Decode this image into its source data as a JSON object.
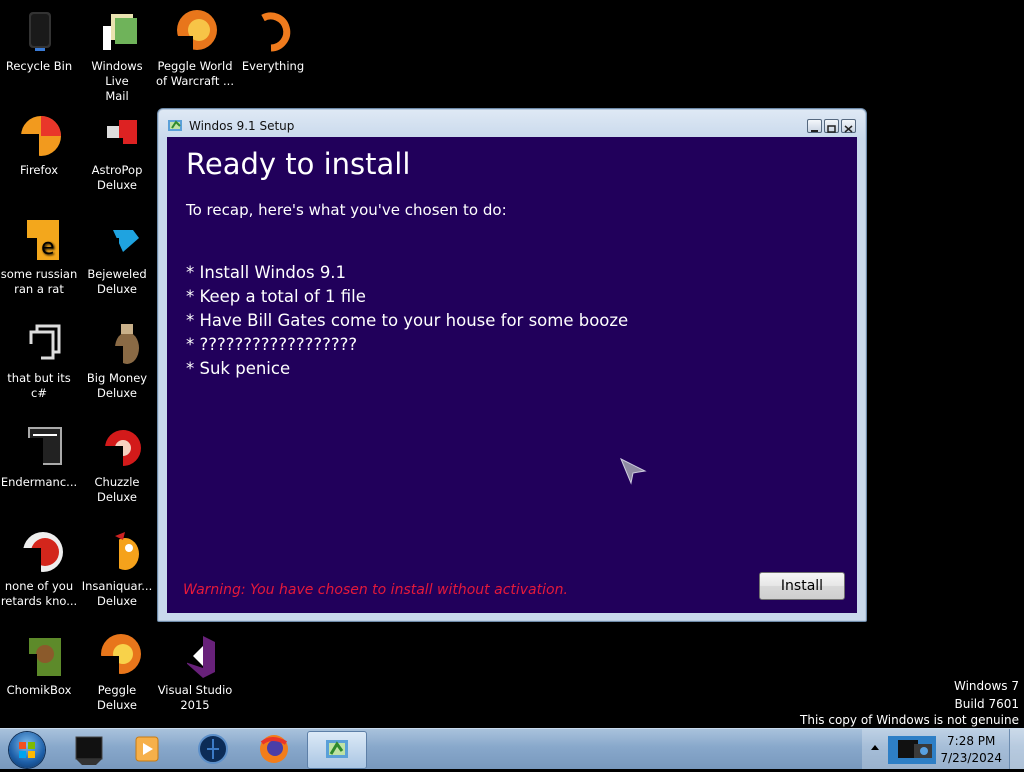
{
  "desktop": {
    "icons": [
      {
        "label": "Recycle Bin",
        "icon": "recycle-bin-icon"
      },
      {
        "label": "Windows Live\nMail",
        "icon": "windows-live-mail-icon"
      },
      {
        "label": "Peggle World\nof Warcraft ...",
        "icon": "peggle-wow-icon"
      },
      {
        "label": "Everything",
        "icon": "everything-search-icon"
      },
      {
        "label": "Firefox",
        "icon": "firefox-icon"
      },
      {
        "label": "AstroPop\nDeluxe",
        "icon": "astropop-icon"
      },
      {
        "label": "some russian\nran a rat",
        "icon": "file-icon"
      },
      {
        "label": "Bejeweled\nDeluxe",
        "icon": "bejeweled-icon"
      },
      {
        "label": "that but its c#",
        "icon": "copy-files-icon"
      },
      {
        "label": "Big Money\nDeluxe",
        "icon": "big-money-icon"
      },
      {
        "label": "Endermanc...",
        "icon": "window-app-icon"
      },
      {
        "label": "Chuzzle\nDeluxe",
        "icon": "chuzzle-icon"
      },
      {
        "label": "none of you\nretards kno...",
        "icon": "peggle-icon"
      },
      {
        "label": "Insaniquar...\nDeluxe",
        "icon": "insaniquarium-icon"
      },
      {
        "label": "ChomikBox",
        "icon": "chomikbox-icon"
      },
      {
        "label": "Peggle Deluxe",
        "icon": "peggle-deluxe-icon"
      },
      {
        "label": "Visual Studio\n2015",
        "icon": "visual-studio-icon"
      }
    ]
  },
  "window": {
    "title": "Windos 9.1 Setup",
    "heading": "Ready to install",
    "recap": "To recap, here's what you've chosen to do:",
    "items": [
      "* Install Windos 9.1",
      "* Keep a total of 1 file",
      "* Have Bill Gates come to your house for some booze",
      "* ??????????????????",
      "* Suk penice"
    ],
    "warning": "Warning: You have chosen to install without activation.",
    "install_label": "Install",
    "colors": {
      "client_bg": "#21005b",
      "warning": "#e5193a"
    }
  },
  "watermark": {
    "line1": "Windows 7",
    "line2": "Build 7601",
    "line3": "This copy of Windows is not genuine"
  },
  "taskbar": {
    "apps": [
      "cmd-icon",
      "media-player-icon",
      "bluetooth-globe-icon",
      "firefox-icon",
      "setup-app-icon"
    ],
    "clock_time": "7:28 PM",
    "clock_date": "7/23/2024"
  }
}
